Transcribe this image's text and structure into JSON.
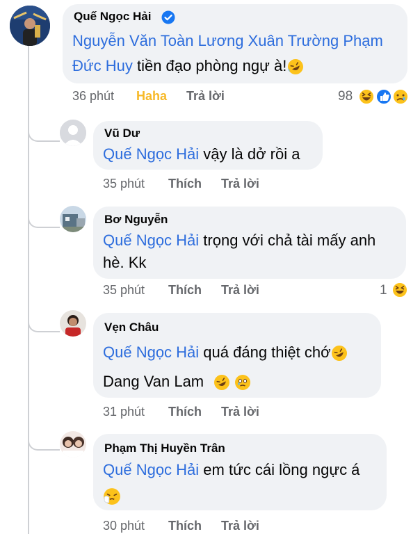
{
  "comments": [
    {
      "author": "Quế Ngọc Hải",
      "verified": true,
      "line1_mention": "Nguyễn Văn Toàn Lương Xuân Trường Phạm",
      "line2_mention": "Đức Huy",
      "line2_text": " tiền đạo phòng ngự à!",
      "time": "36 phút",
      "action_react": "Haha",
      "action_reply": "Trả lời",
      "reaction_count": "98",
      "reaction_icons": [
        "haha-icon",
        "like-icon",
        "sad-icon"
      ]
    },
    {
      "author": "Vũ Dư",
      "mention": "Quế Ngọc Hải",
      "text": " vậy là dở rồi a",
      "time": "35 phút",
      "action_like": "Thích",
      "action_reply": "Trả lời"
    },
    {
      "author": "Bơ Nguyễn",
      "mention": "Quế Ngọc Hải",
      "text": " trọng với chả tài mấy anh",
      "text2": "hè. Kk",
      "time": "35 phút",
      "action_like": "Thích",
      "action_reply": "Trả lời",
      "reaction_count": "1",
      "reaction_icons": [
        "haha-icon"
      ]
    },
    {
      "author": "Vẹn Châu",
      "mention": "Quế Ngọc Hải",
      "text": " quá đáng thiệt chớ",
      "text2": "Dang Van Lam",
      "time": "31 phút",
      "action_like": "Thích",
      "action_reply": "Trả lời"
    },
    {
      "author": "Phạm Thị Huyền Trân",
      "mention": "Quế Ngọc Hải",
      "text": " em tức cái lồng ngực á",
      "time": "30 phút",
      "action_like": "Thích",
      "action_reply": "Trả lời"
    }
  ],
  "colors": {
    "mention": "#2d6ddd",
    "bubble": "#f0f2f5",
    "meta": "#65676b",
    "haha": "#f7b928",
    "verified": "#1877f2"
  }
}
